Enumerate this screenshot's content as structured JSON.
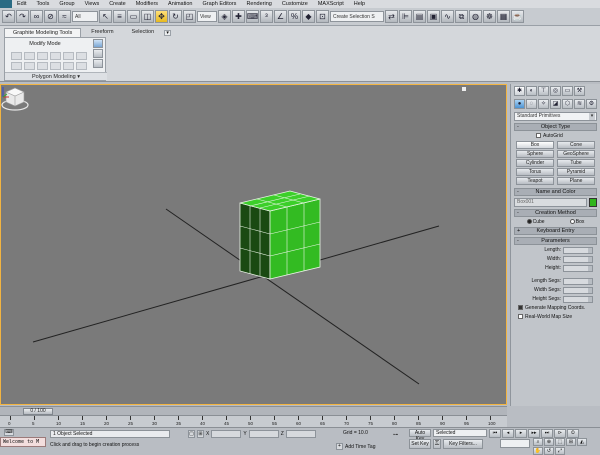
{
  "menubar": {
    "items": [
      "Edit",
      "Tools",
      "Group",
      "Views",
      "Create",
      "Modifiers",
      "Animation",
      "Graph Editors",
      "Rendering",
      "Customize",
      "MAXScript",
      "Help"
    ]
  },
  "toolbar": {
    "selection_filter": "All",
    "view_dropdown": "View",
    "named_selection_placeholder": "Create Selection S"
  },
  "ribbon": {
    "tabs": [
      "Graphite Modeling Tools",
      "Freeform",
      "Selection"
    ],
    "panel_title": "Modify Mode",
    "panel_label": "Polygon Modeling"
  },
  "command_panel": {
    "category_dropdown": "Standard Primitives",
    "object_type": {
      "title": "Object Type",
      "autogrid_label": "AutoGrid",
      "buttons": [
        "Box",
        "Cone",
        "Sphere",
        "GeoSphere",
        "Cylinder",
        "Tube",
        "Torus",
        "Pyramid",
        "Teapot",
        "Plane"
      ]
    },
    "name_and_color": {
      "title": "Name and Color",
      "name_value": "Box001",
      "color": "#2fb51c"
    },
    "creation_method": {
      "title": "Creation Method",
      "options": [
        "Cube",
        "Box"
      ],
      "selected": "Cube"
    },
    "keyboard_entry": {
      "title": "Keyboard Entry"
    },
    "parameters": {
      "title": "Parameters",
      "fields": [
        "Length:",
        "Width:",
        "Height:",
        "Length Segs:",
        "Width Segs:",
        "Height Segs:"
      ],
      "checkboxes": [
        "Generate Mapping Coords.",
        "Real-World Map Size"
      ]
    }
  },
  "timeline": {
    "slider_label": "0 / 100",
    "ticks": [
      "0",
      "5",
      "10",
      "15",
      "20",
      "25",
      "30",
      "35",
      "40",
      "45",
      "50",
      "55",
      "60",
      "65",
      "70",
      "75",
      "80",
      "85",
      "90",
      "95",
      "100"
    ]
  },
  "status": {
    "listener": "Welcome to M",
    "selection": "1 Object Selected",
    "prompt": "Click and drag to begin creation process",
    "x_label": "X",
    "y_label": "Y",
    "z_label": "Z",
    "grid": "Grid = 10.0",
    "time_tag": "Add Time Tag",
    "auto_key": "Auto Key",
    "set_key": "Set Key",
    "selected_dropdown": "Selected",
    "key_filters": "Key Filters..."
  },
  "colors": {
    "viewport_bg": "#7a7a7a",
    "viewport_border": "#f2b441",
    "box_green": "#2fb51c"
  }
}
